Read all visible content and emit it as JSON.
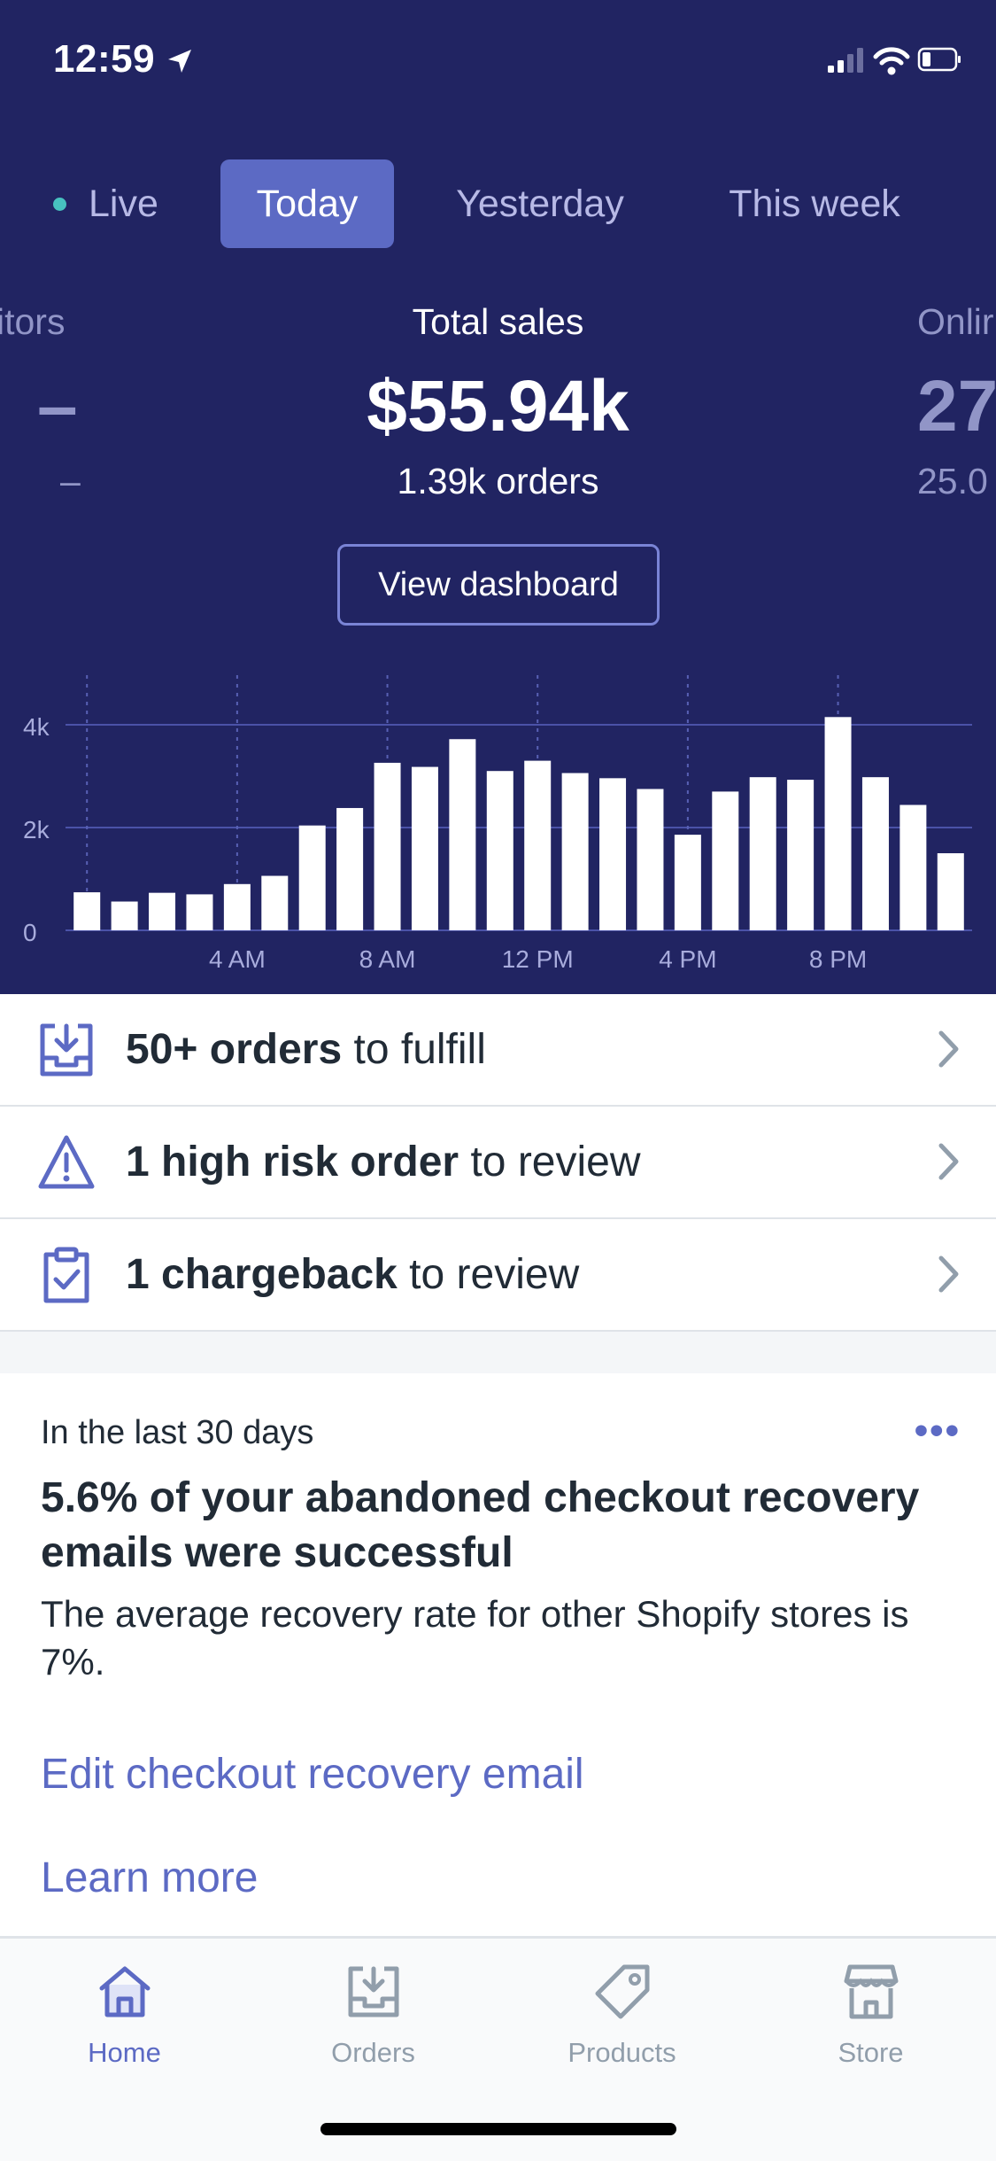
{
  "status_bar": {
    "time": "12:59"
  },
  "tabs": [
    {
      "label": "Live",
      "selected": false
    },
    {
      "label": "Today",
      "selected": true
    },
    {
      "label": "Yesterday",
      "selected": false
    },
    {
      "label": "This week",
      "selected": false
    }
  ],
  "metrics": {
    "left": {
      "label": "itors",
      "value": "–",
      "sub": "–"
    },
    "center": {
      "label": "Total sales",
      "value": "$55.94k",
      "sub": "1.39k orders"
    },
    "right": {
      "label": "Onlir",
      "value": "27",
      "sub": "25.0"
    }
  },
  "view_dashboard_label": "View dashboard",
  "chart_data": {
    "type": "bar",
    "x": [
      "12 AM",
      "1 AM",
      "2 AM",
      "3 AM",
      "4 AM",
      "5 AM",
      "6 AM",
      "7 AM",
      "8 AM",
      "9 AM",
      "10 AM",
      "11 AM",
      "12 PM",
      "1 PM",
      "2 PM",
      "3 PM",
      "4 PM",
      "5 PM",
      "6 PM",
      "7 PM",
      "8 PM",
      "9 PM",
      "10 PM",
      "11 PM"
    ],
    "values": [
      740,
      560,
      730,
      700,
      900,
      1060,
      2040,
      2380,
      3260,
      3180,
      3720,
      3100,
      3300,
      3060,
      2960,
      2750,
      1860,
      2700,
      2980,
      2930,
      4150,
      2980,
      2440,
      1500
    ],
    "ylim": [
      0,
      4000
    ],
    "y_ticks": [
      "0",
      "2k",
      "4k"
    ],
    "x_tick_labels": [
      "4 AM",
      "8 AM",
      "12 PM",
      "4 PM",
      "8 PM"
    ],
    "grid": true
  },
  "tasks": [
    {
      "bold": "50+ orders",
      "rest": " to fulfill",
      "icon": "inbox-icon"
    },
    {
      "bold": "1 high risk order",
      "rest": " to review",
      "icon": "warning-icon"
    },
    {
      "bold": "1 chargeback",
      "rest": " to review",
      "icon": "clipboard-check-icon"
    }
  ],
  "card": {
    "eyebrow": "In the last 30 days",
    "menu": "•••",
    "title": "5.6% of your abandoned checkout recovery emails were successful",
    "body": "The average recovery rate for other Shopify stores is 7%.",
    "link1": "Edit checkout recovery email",
    "link2": "Learn more"
  },
  "tab_bar": [
    {
      "label": "Home",
      "icon": "home-icon",
      "active": true
    },
    {
      "label": "Orders",
      "icon": "orders-icon",
      "active": false
    },
    {
      "label": "Products",
      "icon": "tag-icon",
      "active": false
    },
    {
      "label": "Store",
      "icon": "store-icon",
      "active": false
    }
  ],
  "colors": {
    "hero": "#212462",
    "accent": "#5c6ac4",
    "live_dot": "#47c1bf"
  }
}
